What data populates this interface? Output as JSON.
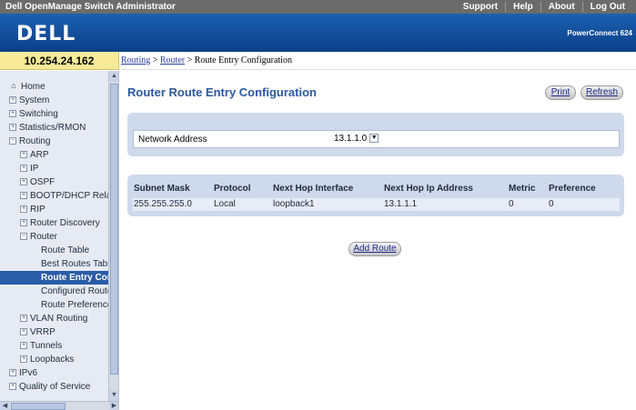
{
  "topbar": {
    "title": "Dell OpenManage Switch Administrator",
    "links": [
      "Support",
      "Help",
      "About",
      "Log Out"
    ]
  },
  "banner": {
    "logo": "DELL",
    "product": "PowerConnect 624"
  },
  "ip_address": "10.254.24.162",
  "breadcrumb": {
    "items": [
      "Routing",
      "Router"
    ],
    "current": "Route Entry Configuration",
    "sep": ">"
  },
  "nav": [
    {
      "label": "Home",
      "level": 0,
      "sym": "home"
    },
    {
      "label": "System",
      "level": 0,
      "sym": "+"
    },
    {
      "label": "Switching",
      "level": 0,
      "sym": "+"
    },
    {
      "label": "Statistics/RMON",
      "level": 0,
      "sym": "+"
    },
    {
      "label": "Routing",
      "level": 0,
      "sym": "-"
    },
    {
      "label": "ARP",
      "level": 1,
      "sym": "+"
    },
    {
      "label": "IP",
      "level": 1,
      "sym": "+"
    },
    {
      "label": "OSPF",
      "level": 1,
      "sym": "+"
    },
    {
      "label": "BOOTP/DHCP Relay",
      "level": 1,
      "sym": "+"
    },
    {
      "label": "RIP",
      "level": 1,
      "sym": "+"
    },
    {
      "label": "Router Discovery",
      "level": 1,
      "sym": "+"
    },
    {
      "label": "Router",
      "level": 1,
      "sym": "-"
    },
    {
      "label": "Route Table",
      "level": 2,
      "sym": ""
    },
    {
      "label": "Best Routes Table",
      "level": 2,
      "sym": ""
    },
    {
      "label": "Route Entry Conf",
      "level": 2,
      "sym": "",
      "active": true
    },
    {
      "label": "Configured Routes",
      "level": 2,
      "sym": ""
    },
    {
      "label": "Route Preferences",
      "level": 2,
      "sym": ""
    },
    {
      "label": "VLAN Routing",
      "level": 1,
      "sym": "+"
    },
    {
      "label": "VRRP",
      "level": 1,
      "sym": "+"
    },
    {
      "label": "Tunnels",
      "level": 1,
      "sym": "+"
    },
    {
      "label": "Loopbacks",
      "level": 1,
      "sym": "+"
    },
    {
      "label": "IPv6",
      "level": 0,
      "sym": "+"
    },
    {
      "label": "Quality of Service",
      "level": 0,
      "sym": "+"
    }
  ],
  "page": {
    "title": "Router Route Entry Configuration",
    "print_label": "Print",
    "refresh_label": "Refresh",
    "network_address_label": "Network Address",
    "network_address_value": "13.1.1.0",
    "add_route_label": "Add Route"
  },
  "table": {
    "headers": [
      "Subnet Mask",
      "Protocol",
      "Next Hop Interface",
      "Next Hop Ip Address",
      "Metric",
      "Preference"
    ],
    "rows": [
      [
        "255.255.255.0",
        "Local",
        "loopback1",
        "13.1.1.1",
        "0",
        "0"
      ]
    ]
  }
}
